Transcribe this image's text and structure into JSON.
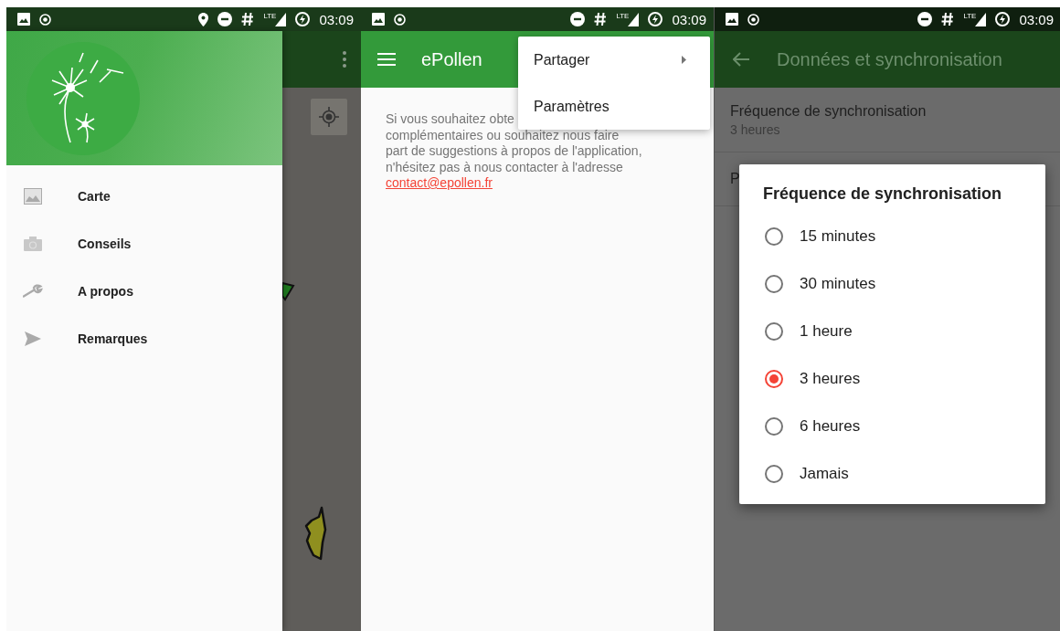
{
  "screens": [
    {
      "kind": "drawer",
      "status_bar": {
        "time": "03:09",
        "network": "LTE",
        "location": true
      },
      "drawer": {
        "items": [
          {
            "label": "Carte"
          },
          {
            "label": "Conseils"
          },
          {
            "label": "A propos"
          },
          {
            "label": "Remarques"
          }
        ]
      }
    },
    {
      "kind": "about",
      "status_bar": {
        "time": "03:09",
        "network": "LTE",
        "location": false
      },
      "app_bar": {
        "title": "ePollen"
      },
      "body": {
        "lines": [
          "Si vous souhaitez obte",
          "complémentaires ou souhaitez nous faire",
          "part de suggestions à propos de l'application,",
          "n'hésitez pas à nous contacter à l'adresse"
        ],
        "link": "contact@epollen.fr"
      },
      "menu": {
        "items": [
          {
            "label": "Partager",
            "submenu": true
          },
          {
            "label": "Paramètres",
            "submenu": false
          }
        ]
      }
    },
    {
      "kind": "settings",
      "status_bar": {
        "time": "03:09",
        "network": "LTE",
        "location": false
      },
      "app_bar": {
        "title": "Données et synchronisation"
      },
      "preferences": [
        {
          "title": "Fréquence de synchronisation",
          "summary": "3 heures"
        },
        {
          "title": "P"
        }
      ],
      "dialog": {
        "title": "Fréquence de synchronisation",
        "options": [
          {
            "label": "15 minutes",
            "selected": false
          },
          {
            "label": "30 minutes",
            "selected": false
          },
          {
            "label": "1 heure",
            "selected": false
          },
          {
            "label": "3 heures",
            "selected": true
          },
          {
            "label": "6 heures",
            "selected": false
          },
          {
            "label": "Jamais",
            "selected": false
          }
        ]
      }
    }
  ]
}
